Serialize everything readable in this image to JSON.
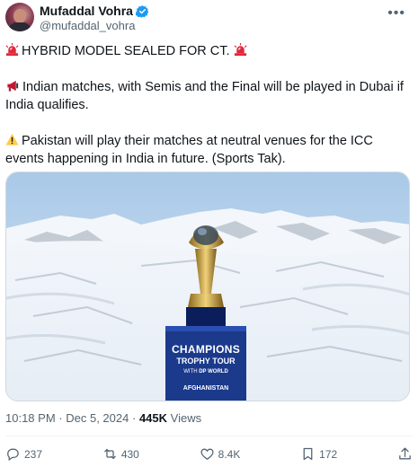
{
  "author": {
    "display_name": "Mufaddal Vohra",
    "handle": "@mufaddal_vohra"
  },
  "tweet": {
    "line1": "HYBRID MODEL SEALED FOR CT.",
    "line2": "Indian matches, with Semis and the Final will be played in Dubai if India qualifies.",
    "line3": "Pakistan will play their matches at neutral venues for the ICC events happening in India in future. (Sports Tak)."
  },
  "media": {
    "banner_title": "CHAMPIONS",
    "banner_subtitle": "TROPHY TOUR",
    "banner_with": "WITH",
    "banner_sponsor": "DP WORLD",
    "banner_location": "AFGHANISTAN"
  },
  "meta": {
    "time": "10:18 PM",
    "sep": "·",
    "date": "Dec 5, 2024",
    "views_count": "445K",
    "views_label": "Views"
  },
  "actions": {
    "replies": "237",
    "reposts": "430",
    "likes": "8.4K",
    "bookmarks": "172"
  },
  "icons": {
    "emoji1": "siren-icon",
    "emoji2": "megaphone-icon",
    "emoji3": "warning-icon",
    "verified_color": "#1d9bf0"
  }
}
